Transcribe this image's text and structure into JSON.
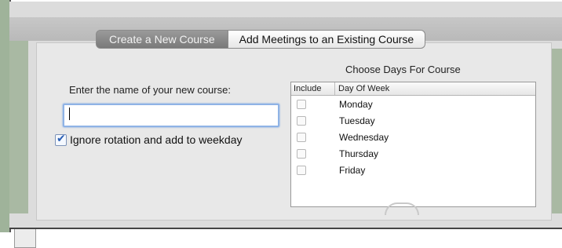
{
  "tabs": {
    "create_label": "Create a New Course",
    "add_label": "Add Meetings to an Existing Course"
  },
  "form": {
    "name_label": "Enter the name of your new course:",
    "name_value": "",
    "ignore_label": "Ignore rotation and add to weekday",
    "ignore_checked": true
  },
  "days": {
    "title": "Choose Days For Course",
    "col_include": "Include",
    "col_day": "Day Of Week",
    "rows": [
      {
        "label": "Monday",
        "checked": false
      },
      {
        "label": "Tuesday",
        "checked": false
      },
      {
        "label": "Wednesday",
        "checked": false
      },
      {
        "label": "Thursday",
        "checked": false
      },
      {
        "label": "Friday",
        "checked": false
      }
    ]
  },
  "colors": {
    "active_tab": "#8a8a8a",
    "focus_ring": "#8fb3e6",
    "background_green": "#a9b9a3"
  }
}
